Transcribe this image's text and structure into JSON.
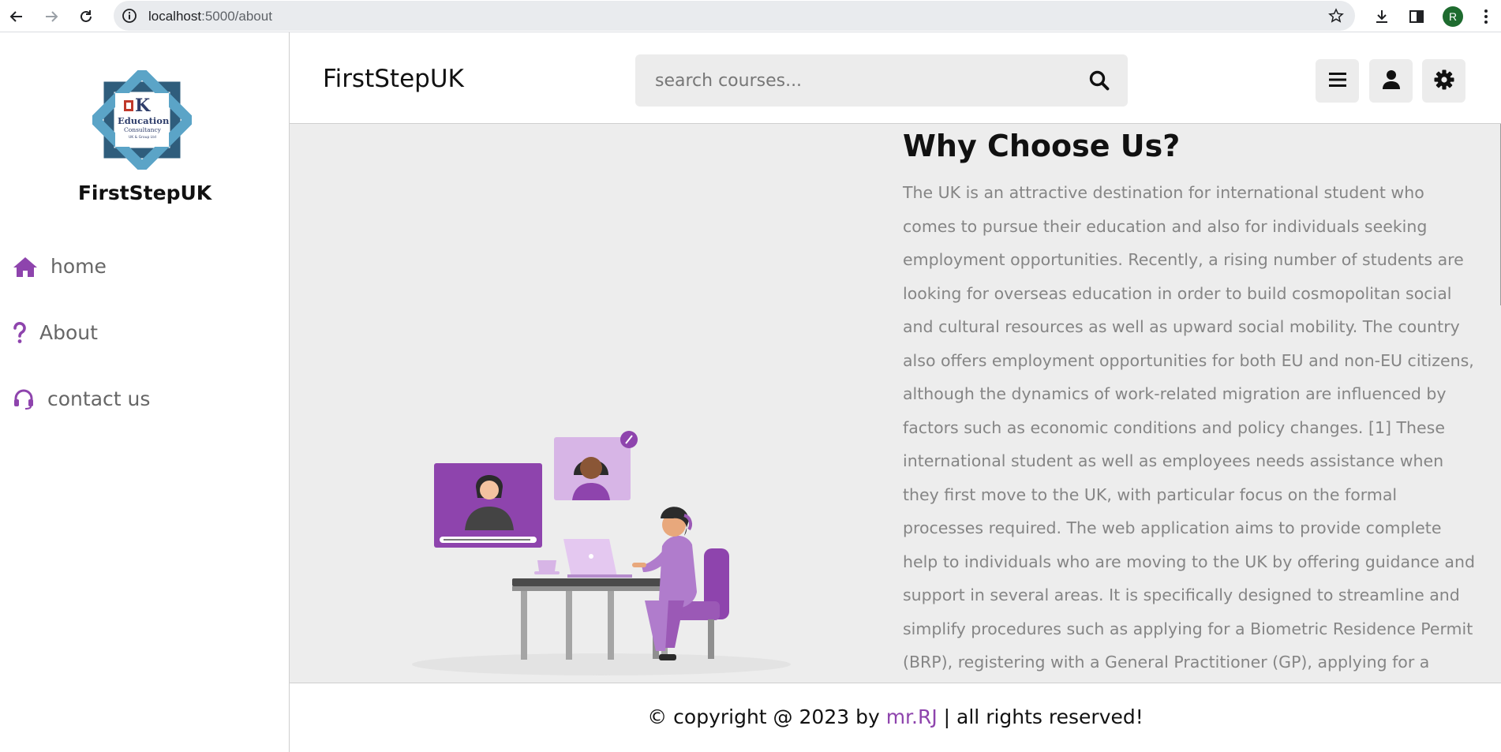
{
  "browser": {
    "url_host": "localhost",
    "url_path": ":5000/about",
    "profile_initial": "R"
  },
  "sidebar": {
    "brand": "FirstStepUK",
    "logo": {
      "line1": "UK",
      "line2": "Education",
      "line3": "Consultancy",
      "line4": "UK & Group Ltd"
    },
    "items": [
      {
        "label": "home",
        "icon": "home-icon"
      },
      {
        "label": "About",
        "icon": "question-icon"
      },
      {
        "label": "contact us",
        "icon": "headset-icon"
      }
    ]
  },
  "header": {
    "brand": "FirstStepUK",
    "search_placeholder": "search courses...",
    "buttons": [
      "menu-icon",
      "user-icon",
      "gear-icon"
    ]
  },
  "about": {
    "title": "Why Choose Us?",
    "text": "The UK is an attractive destination for international student who comes to pursue their education and also for individuals seeking employment opportunities. Recently, a rising number of students are looking for overseas education in order to build cosmopolitan social and cultural resources as well as upward social mobility. The country also offers employment opportunities for both EU and non-EU citizens, although the dynamics of work-related migration are influenced by factors such as economic conditions and policy changes. [1] These international student as well as employees needs assistance when they first move to the UK, with particular focus on the formal processes required. The web application aims to provide complete help to individuals who are moving to the UK by offering guidance and support in several areas. It is specifically designed to streamline and simplify procedures such as applying for a Biometric Residence Permit (BRP), registering with a General Practitioner (GP), applying for a National Insurance (NI) number, opening a bank account and"
  },
  "footer": {
    "prefix": "© copyright @ 2023 by ",
    "author": "mr.RJ",
    "suffix": " | all rights reserved!"
  },
  "colors": {
    "accent": "#8e44ad",
    "content_bg": "#ededed"
  }
}
